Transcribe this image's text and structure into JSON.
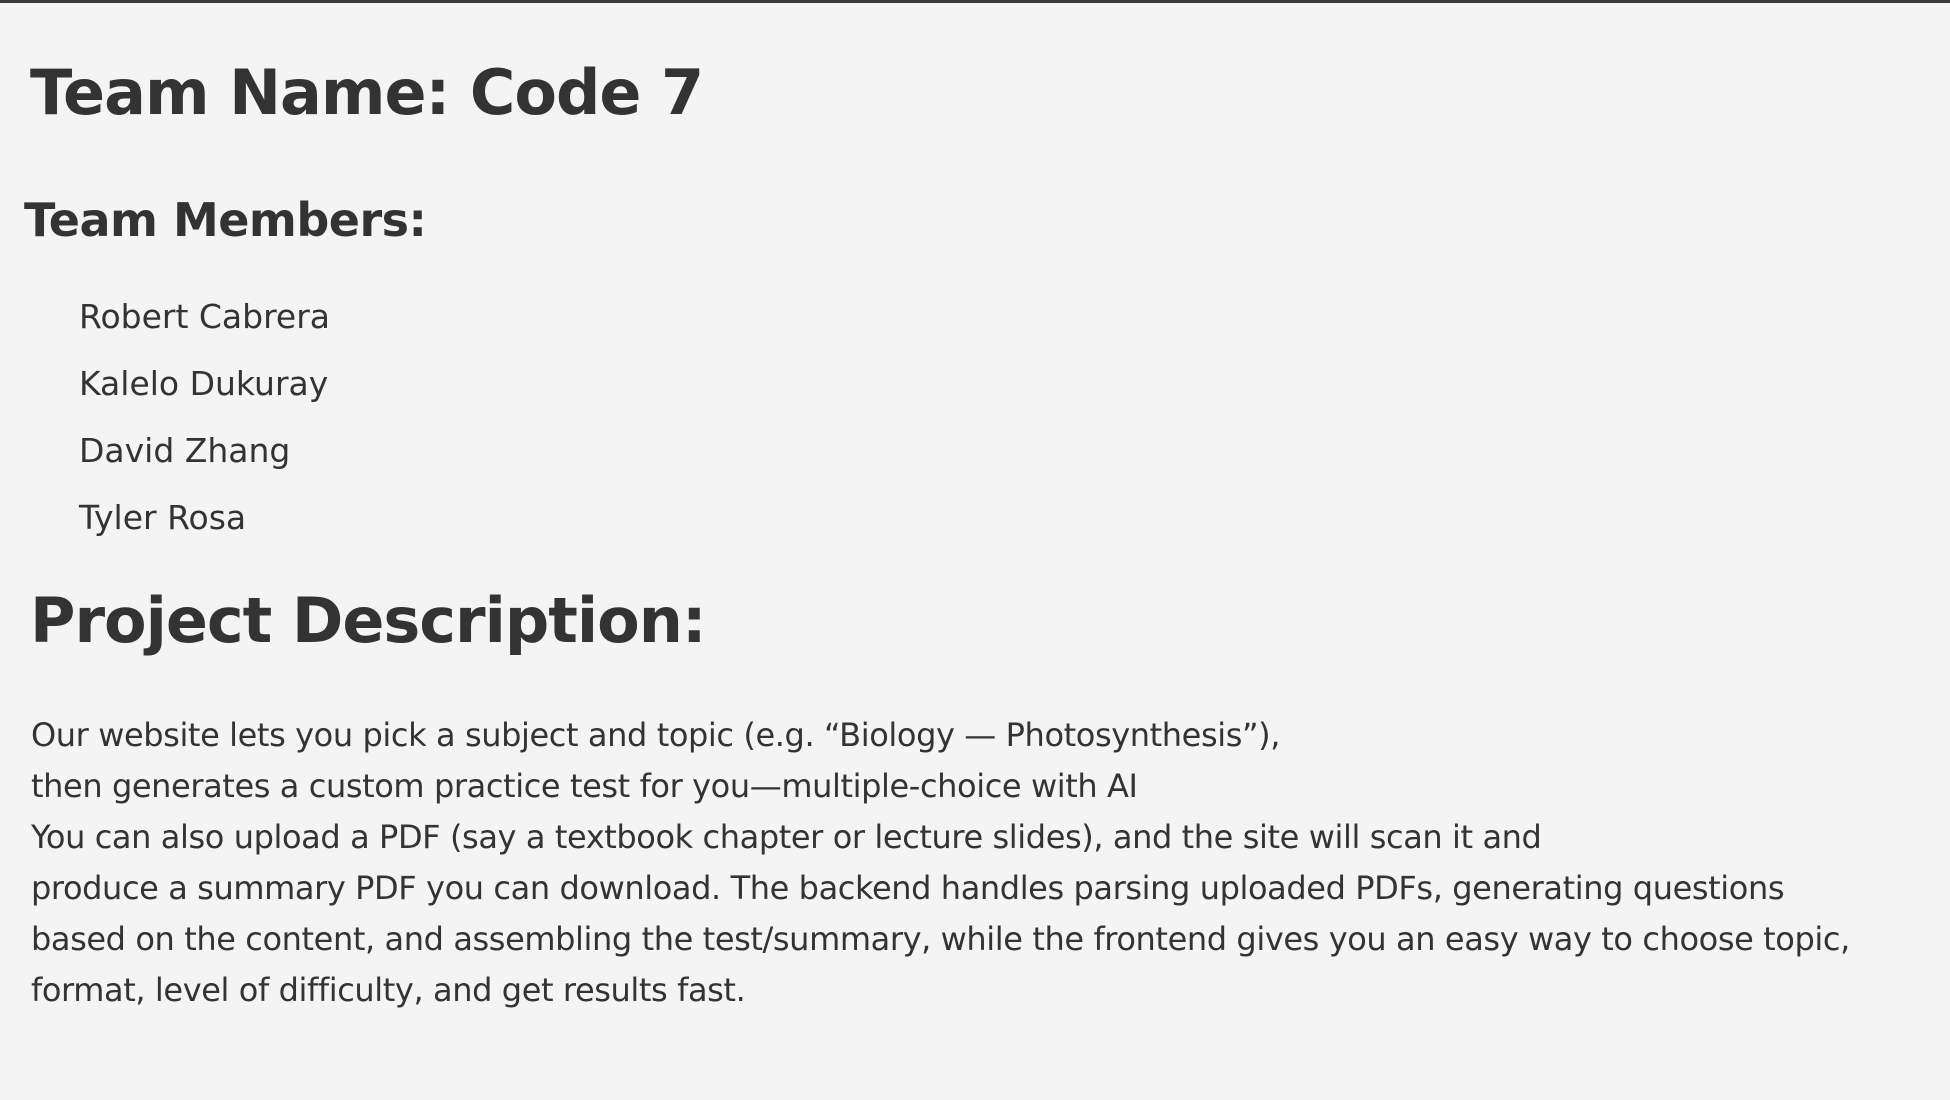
{
  "header": {
    "team_name": "Team Name: Code 7"
  },
  "members": {
    "heading": "Team Members:",
    "items": [
      "Robert Cabrera",
      "Kalelo Dukuray",
      "David Zhang",
      "Tyler Rosa"
    ]
  },
  "description": {
    "heading": "Project Description:",
    "lines": [
      "Our website lets you pick a subject and topic (e.g. “Biology — Photosynthesis”),",
      "then generates a custom practice test for you—multiple-choice with AI",
      "You can also upload a PDF (say a textbook chapter or lecture slides), and the site will scan it and",
      "produce a summary PDF you can download. The backend handles parsing uploaded PDFs, generating questions",
      "based on the content, and assembling the test/summary, while the frontend gives you an easy way to choose topic,",
      "format, level of difficulty, and get results fast."
    ]
  }
}
